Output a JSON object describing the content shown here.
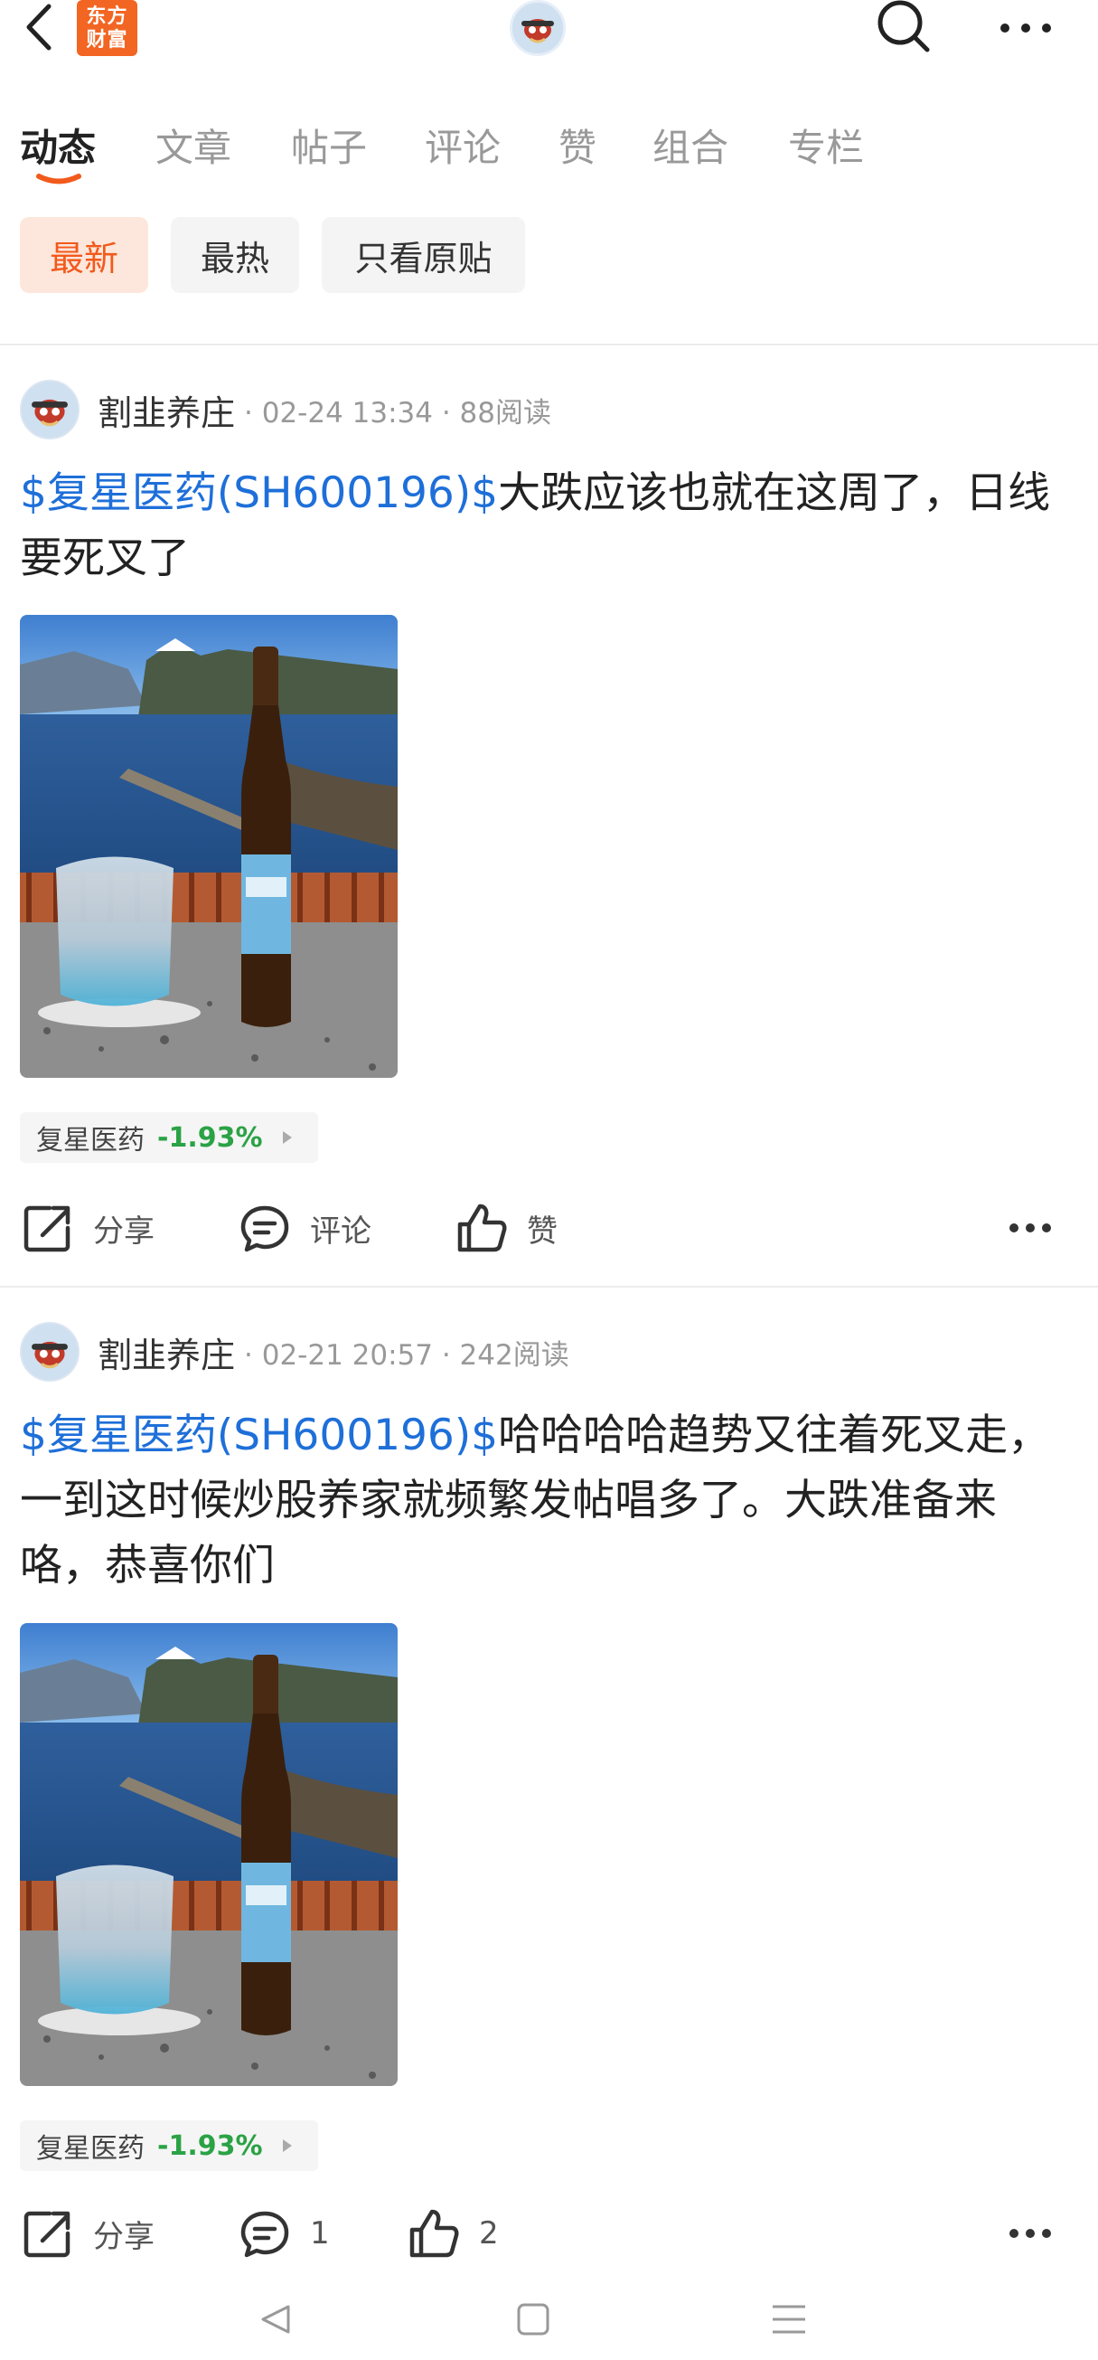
{
  "header": {
    "logo_text_line1": "东方",
    "logo_text_line2": "财富",
    "logo_color": "#f26522"
  },
  "tabs": [
    {
      "label": "动态",
      "active": true
    },
    {
      "label": "文章",
      "active": false
    },
    {
      "label": "帖子",
      "active": false
    },
    {
      "label": "评论",
      "active": false
    },
    {
      "label": "赞",
      "active": false
    },
    {
      "label": "组合",
      "active": false
    },
    {
      "label": "专栏",
      "active": false
    }
  ],
  "filters": [
    {
      "label": "最新",
      "active": true
    },
    {
      "label": "最热",
      "active": false
    },
    {
      "label": "只看原贴",
      "active": false
    }
  ],
  "posts": [
    {
      "author": "割韭养庄",
      "meta": "· 02-24 13:34 · 88阅读",
      "stock_link": "$复星医药(SH600196)$",
      "text": "大跌应该也就在这周了，日线要死叉了",
      "stock_tag": {
        "name": "复星医药",
        "change": "-1.93%"
      },
      "actions": {
        "share": "分享",
        "comment": "评论",
        "like": "赞"
      }
    },
    {
      "author": "割韭养庄",
      "meta": "· 02-21 20:57 · 242阅读",
      "stock_link": "$复星医药(SH600196)$",
      "text": "哈哈哈哈趋势又往着死叉走，一到这时候炒股养家就频繁发帖唱多了。大跌准备来咯，恭喜你们",
      "stock_tag": {
        "name": "复星医药",
        "change": "-1.93%"
      },
      "actions": {
        "share": "分享",
        "comment": "1",
        "like": "2"
      }
    }
  ],
  "colors": {
    "accent": "#f25a1c",
    "link": "#1e6fd9",
    "down": "#2ba245"
  },
  "icons": [
    "back-icon",
    "app-logo",
    "search-icon",
    "more-icon",
    "share-icon",
    "comment-icon",
    "like-icon",
    "nav-back-icon",
    "nav-home-icon",
    "nav-menu-icon"
  ]
}
